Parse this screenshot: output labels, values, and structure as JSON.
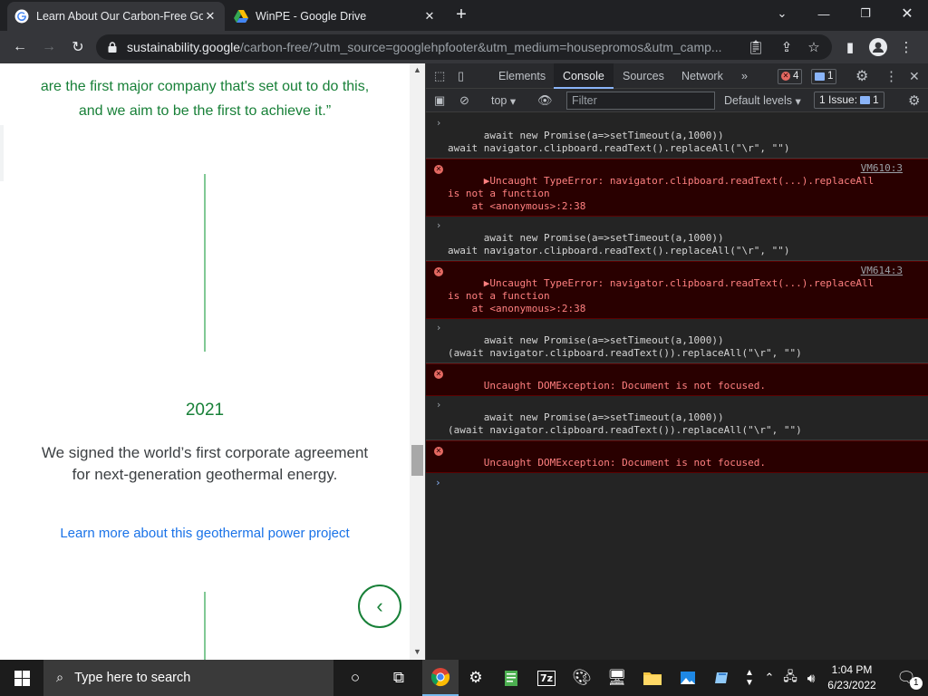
{
  "browser": {
    "tabs": [
      {
        "title": "Learn About Our Carbon-Free Go",
        "active": true
      },
      {
        "title": "WinPE - Google Drive",
        "active": false
      }
    ],
    "url_host": "sustainability.google",
    "url_path": "/carbon-free/?utm_source=googlehpfooter&utm_medium=housepromos&utm_camp..."
  },
  "page": {
    "quote_line_1": "are the first major company that's set out to do this,",
    "quote_line_2": "and we aim to be the first to achieve it.”",
    "year": "2021",
    "description": "We signed the world’s first corporate agreement for next-generation geothermal energy.",
    "link_text": "Learn more about this geothermal power project",
    "prev_button_glyph": "‹"
  },
  "devtools": {
    "tabs": [
      "Elements",
      "Console",
      "Sources",
      "Network"
    ],
    "active_tab": "Console",
    "more_tabs": "»",
    "error_count": "4",
    "message_count": "1",
    "context": "top",
    "filter_placeholder": "Filter",
    "levels": "Default levels",
    "issues_label": "1 Issue:",
    "issues_count": "1",
    "console_rows": [
      {
        "type": "input",
        "l1": "await new Promise(a=>setTimeout(a,1000))",
        "l2": "await navigator.clipboard.readText().replaceAll(\"\\r\", \"\")"
      },
      {
        "type": "error",
        "l1": "▶Uncaught TypeError: navigator.clipboard.readText(...).replaceAll",
        "l2": "is not a function",
        "l3": "    at <anonymous>:2:38",
        "src": "VM610:3"
      },
      {
        "type": "input",
        "l1": "await new Promise(a=>setTimeout(a,1000))",
        "l2": "await navigator.clipboard.readText().replaceAll(\"\\r\", \"\")"
      },
      {
        "type": "error",
        "l1": "▶Uncaught TypeError: navigator.clipboard.readText(...).replaceAll",
        "l2": "is not a function",
        "l3": "    at <anonymous>:2:38",
        "src": "VM614:3"
      },
      {
        "type": "input",
        "l1": "await new Promise(a=>setTimeout(a,1000))",
        "l2": "(await navigator.clipboard.readText()).replaceAll(\"\\r\", \"\")"
      },
      {
        "type": "error",
        "l1": "Uncaught DOMException: Document is not focused."
      },
      {
        "type": "input",
        "l1": "await new Promise(a=>setTimeout(a,1000))",
        "l2": "(await navigator.clipboard.readText()).replaceAll(\"\\r\", \"\")"
      },
      {
        "type": "error",
        "l1": "Uncaught DOMException: Document is not focused."
      }
    ]
  },
  "taskbar": {
    "search_placeholder": "Type here to search",
    "time": "1:04 PM",
    "date": "6/23/2022",
    "notification_count": "1"
  },
  "colors": {
    "google_green": "#188038",
    "link_blue": "#1a73e8",
    "error_bg": "#290000",
    "error_text": "#ff8080"
  }
}
